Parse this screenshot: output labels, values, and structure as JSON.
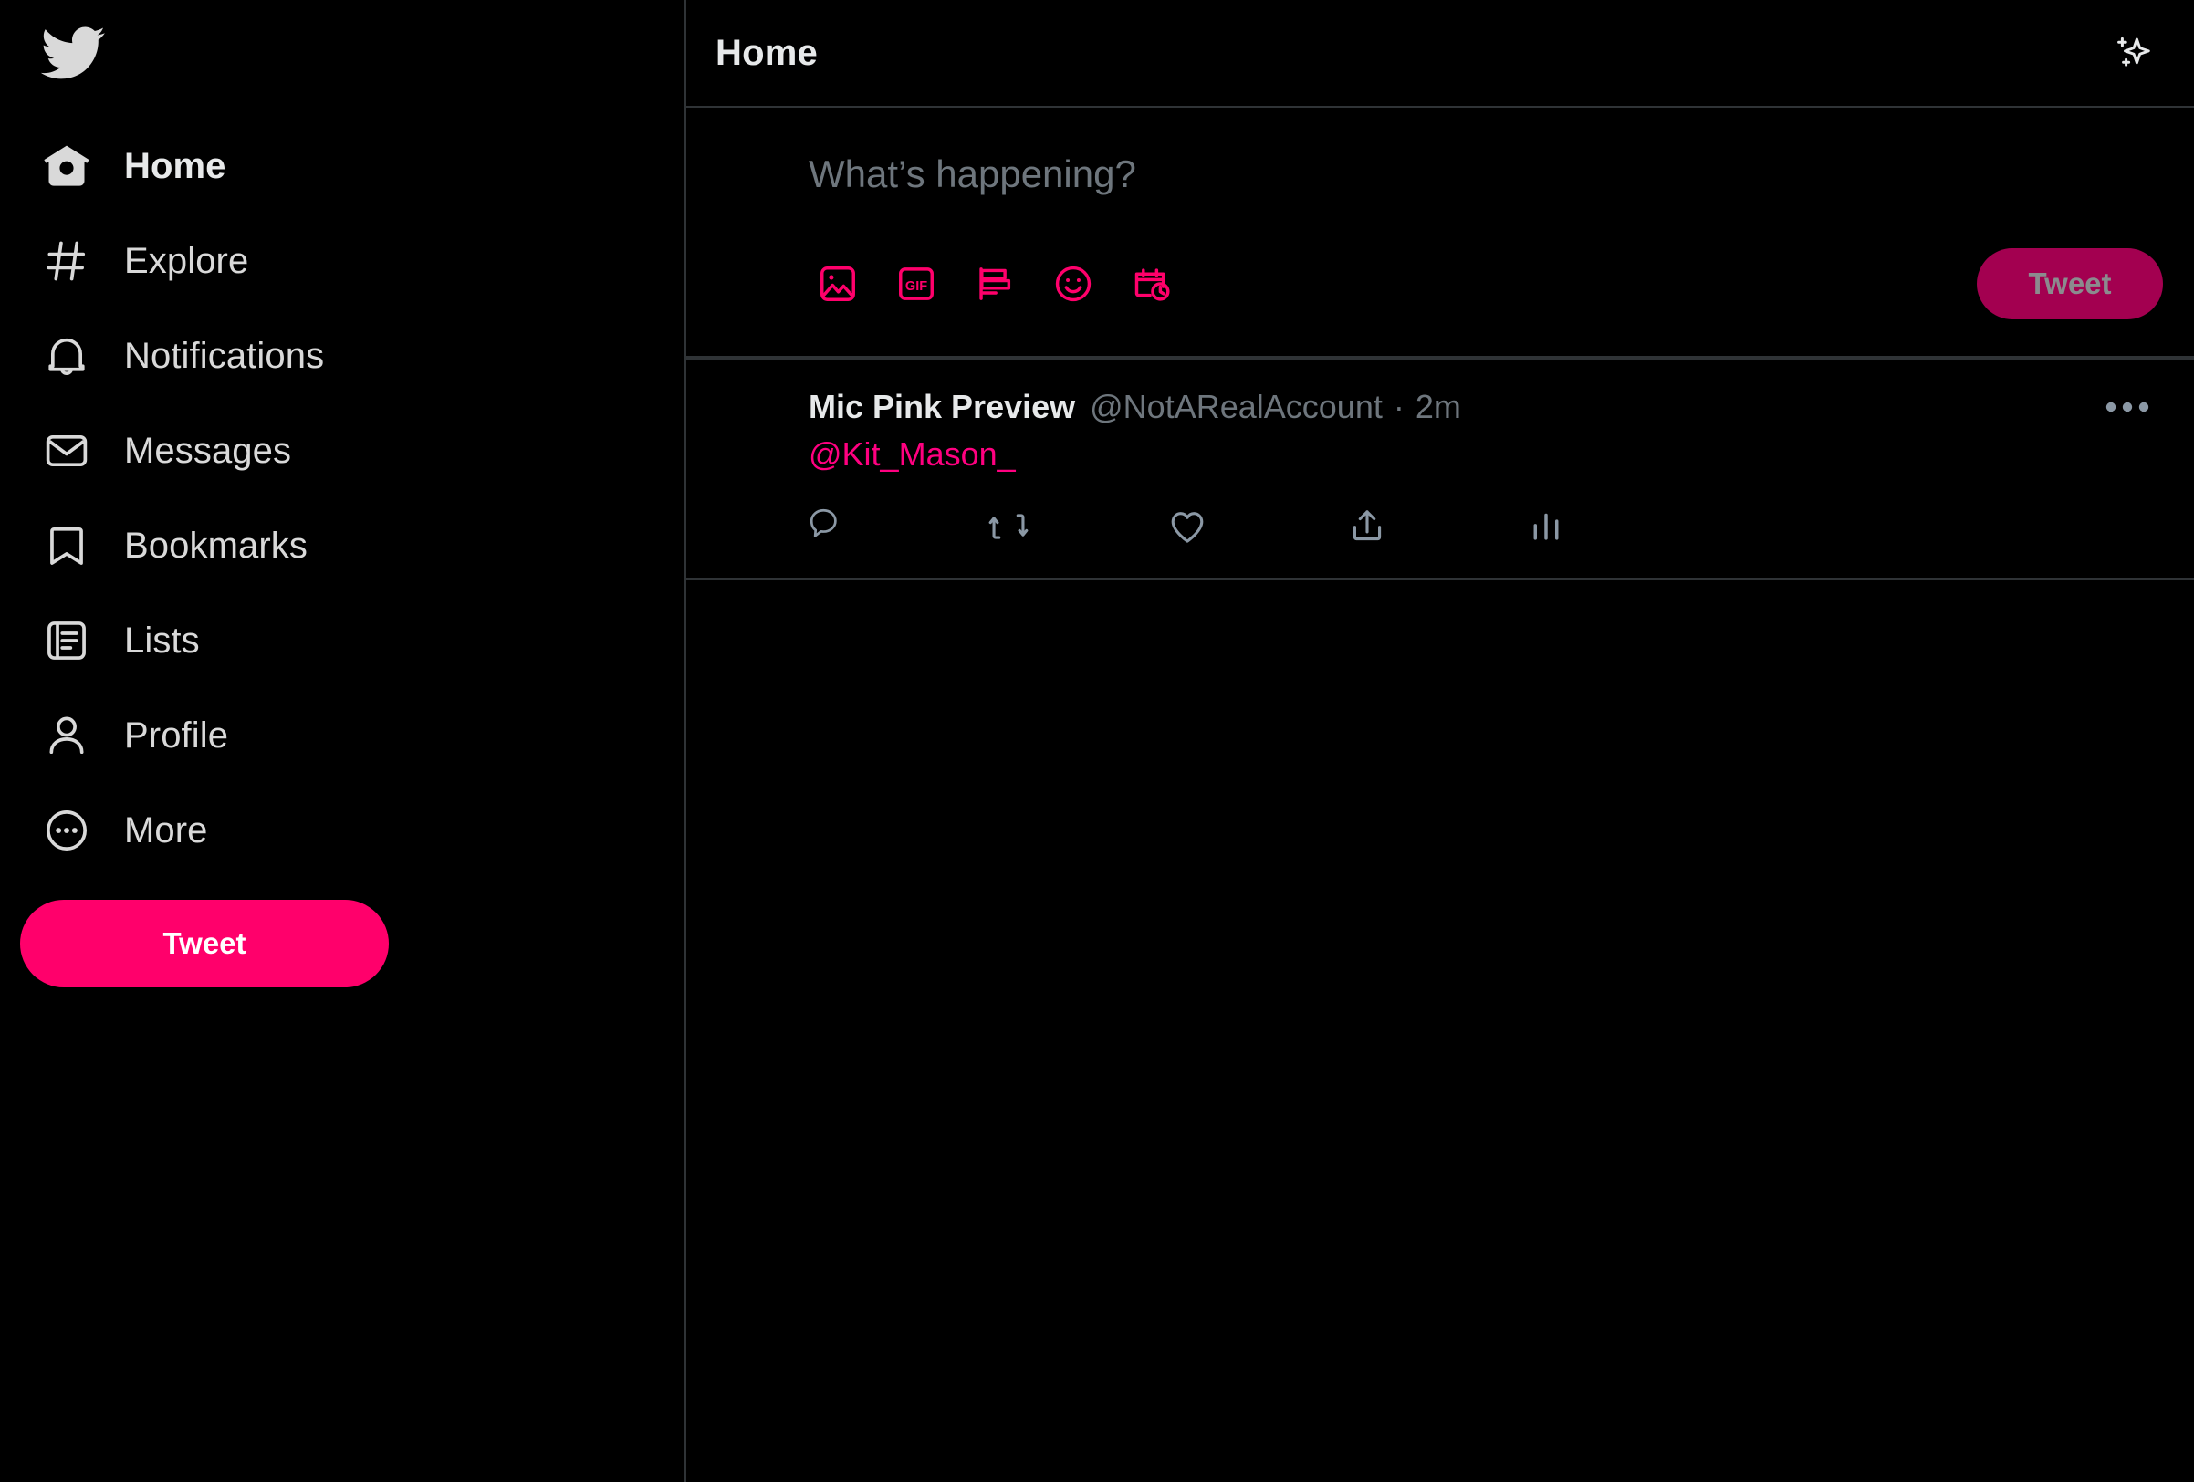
{
  "app": {
    "brand_logo": "twitter-bird-logo",
    "accent_pink": "#FF006B",
    "accent_pink_muted": "#A30050",
    "link_pink": "#FF0080",
    "background": "#000000",
    "divider": "#2f3336",
    "text_primary": "#e7e9ea",
    "text_secondary": "#6e767d"
  },
  "sidebar": {
    "items": [
      {
        "label": "Home",
        "icon": "home-icon",
        "active": true
      },
      {
        "label": "Explore",
        "icon": "hashtag-icon",
        "active": false
      },
      {
        "label": "Notifications",
        "icon": "bell-icon",
        "active": false
      },
      {
        "label": "Messages",
        "icon": "envelope-icon",
        "active": false
      },
      {
        "label": "Bookmarks",
        "icon": "bookmark-icon",
        "active": false
      },
      {
        "label": "Lists",
        "icon": "list-icon",
        "active": false
      },
      {
        "label": "Profile",
        "icon": "person-icon",
        "active": false
      },
      {
        "label": "More",
        "icon": "ellipsis-circle-icon",
        "active": false
      }
    ],
    "tweet_button_label": "Tweet"
  },
  "header": {
    "title": "Home",
    "sparkle_icon": "sparkles-icon"
  },
  "compose": {
    "placeholder": "What’s happening?",
    "tools": [
      {
        "name": "media-icon",
        "title": "Media"
      },
      {
        "name": "gif-icon",
        "title": "GIF",
        "text": "GIF"
      },
      {
        "name": "poll-icon",
        "title": "Poll"
      },
      {
        "name": "emoji-icon",
        "title": "Emoji"
      },
      {
        "name": "schedule-icon",
        "title": "Schedule"
      }
    ],
    "tweet_button_label": "Tweet"
  },
  "tweet": {
    "display_name": "Mic Pink Preview",
    "handle": "@NotARealAccount",
    "separator": "·",
    "timestamp": "2m",
    "body": "@Kit_Mason_",
    "more_icon": "ellipsis-horizontal-icon",
    "actions": [
      {
        "name": "reply-icon",
        "label": ""
      },
      {
        "name": "retweet-icon",
        "label": ""
      },
      {
        "name": "like-icon",
        "label": ""
      },
      {
        "name": "share-icon",
        "label": ""
      },
      {
        "name": "analytics-icon",
        "label": ""
      }
    ]
  }
}
